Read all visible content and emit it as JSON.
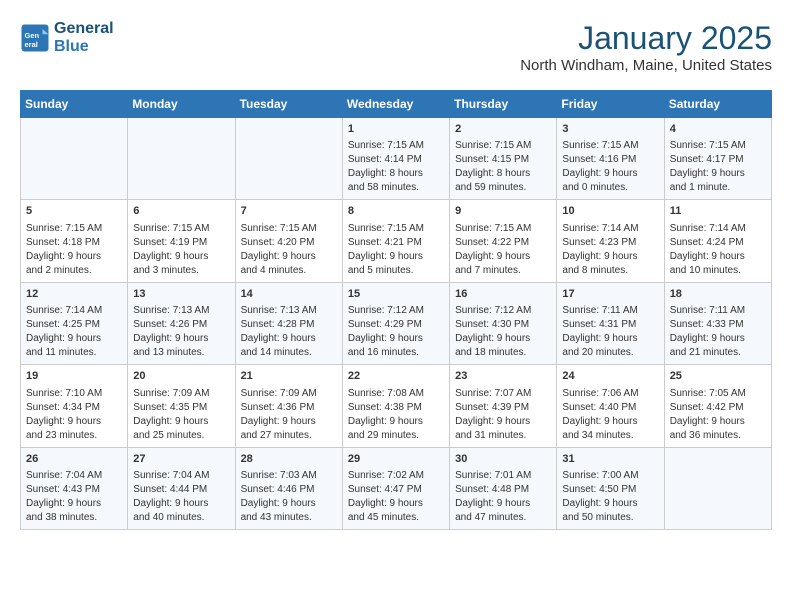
{
  "header": {
    "logo_text_general": "General",
    "logo_text_blue": "Blue",
    "month": "January 2025",
    "location": "North Windham, Maine, United States"
  },
  "days_of_week": [
    "Sunday",
    "Monday",
    "Tuesday",
    "Wednesday",
    "Thursday",
    "Friday",
    "Saturday"
  ],
  "weeks": [
    [
      {
        "day": "",
        "info": ""
      },
      {
        "day": "",
        "info": ""
      },
      {
        "day": "",
        "info": ""
      },
      {
        "day": "1",
        "info": "Sunrise: 7:15 AM\nSunset: 4:14 PM\nDaylight: 8 hours\nand 58 minutes."
      },
      {
        "day": "2",
        "info": "Sunrise: 7:15 AM\nSunset: 4:15 PM\nDaylight: 8 hours\nand 59 minutes."
      },
      {
        "day": "3",
        "info": "Sunrise: 7:15 AM\nSunset: 4:16 PM\nDaylight: 9 hours\nand 0 minutes."
      },
      {
        "day": "4",
        "info": "Sunrise: 7:15 AM\nSunset: 4:17 PM\nDaylight: 9 hours\nand 1 minute."
      }
    ],
    [
      {
        "day": "5",
        "info": "Sunrise: 7:15 AM\nSunset: 4:18 PM\nDaylight: 9 hours\nand 2 minutes."
      },
      {
        "day": "6",
        "info": "Sunrise: 7:15 AM\nSunset: 4:19 PM\nDaylight: 9 hours\nand 3 minutes."
      },
      {
        "day": "7",
        "info": "Sunrise: 7:15 AM\nSunset: 4:20 PM\nDaylight: 9 hours\nand 4 minutes."
      },
      {
        "day": "8",
        "info": "Sunrise: 7:15 AM\nSunset: 4:21 PM\nDaylight: 9 hours\nand 5 minutes."
      },
      {
        "day": "9",
        "info": "Sunrise: 7:15 AM\nSunset: 4:22 PM\nDaylight: 9 hours\nand 7 minutes."
      },
      {
        "day": "10",
        "info": "Sunrise: 7:14 AM\nSunset: 4:23 PM\nDaylight: 9 hours\nand 8 minutes."
      },
      {
        "day": "11",
        "info": "Sunrise: 7:14 AM\nSunset: 4:24 PM\nDaylight: 9 hours\nand 10 minutes."
      }
    ],
    [
      {
        "day": "12",
        "info": "Sunrise: 7:14 AM\nSunset: 4:25 PM\nDaylight: 9 hours\nand 11 minutes."
      },
      {
        "day": "13",
        "info": "Sunrise: 7:13 AM\nSunset: 4:26 PM\nDaylight: 9 hours\nand 13 minutes."
      },
      {
        "day": "14",
        "info": "Sunrise: 7:13 AM\nSunset: 4:28 PM\nDaylight: 9 hours\nand 14 minutes."
      },
      {
        "day": "15",
        "info": "Sunrise: 7:12 AM\nSunset: 4:29 PM\nDaylight: 9 hours\nand 16 minutes."
      },
      {
        "day": "16",
        "info": "Sunrise: 7:12 AM\nSunset: 4:30 PM\nDaylight: 9 hours\nand 18 minutes."
      },
      {
        "day": "17",
        "info": "Sunrise: 7:11 AM\nSunset: 4:31 PM\nDaylight: 9 hours\nand 20 minutes."
      },
      {
        "day": "18",
        "info": "Sunrise: 7:11 AM\nSunset: 4:33 PM\nDaylight: 9 hours\nand 21 minutes."
      }
    ],
    [
      {
        "day": "19",
        "info": "Sunrise: 7:10 AM\nSunset: 4:34 PM\nDaylight: 9 hours\nand 23 minutes."
      },
      {
        "day": "20",
        "info": "Sunrise: 7:09 AM\nSunset: 4:35 PM\nDaylight: 9 hours\nand 25 minutes."
      },
      {
        "day": "21",
        "info": "Sunrise: 7:09 AM\nSunset: 4:36 PM\nDaylight: 9 hours\nand 27 minutes."
      },
      {
        "day": "22",
        "info": "Sunrise: 7:08 AM\nSunset: 4:38 PM\nDaylight: 9 hours\nand 29 minutes."
      },
      {
        "day": "23",
        "info": "Sunrise: 7:07 AM\nSunset: 4:39 PM\nDaylight: 9 hours\nand 31 minutes."
      },
      {
        "day": "24",
        "info": "Sunrise: 7:06 AM\nSunset: 4:40 PM\nDaylight: 9 hours\nand 34 minutes."
      },
      {
        "day": "25",
        "info": "Sunrise: 7:05 AM\nSunset: 4:42 PM\nDaylight: 9 hours\nand 36 minutes."
      }
    ],
    [
      {
        "day": "26",
        "info": "Sunrise: 7:04 AM\nSunset: 4:43 PM\nDaylight: 9 hours\nand 38 minutes."
      },
      {
        "day": "27",
        "info": "Sunrise: 7:04 AM\nSunset: 4:44 PM\nDaylight: 9 hours\nand 40 minutes."
      },
      {
        "day": "28",
        "info": "Sunrise: 7:03 AM\nSunset: 4:46 PM\nDaylight: 9 hours\nand 43 minutes."
      },
      {
        "day": "29",
        "info": "Sunrise: 7:02 AM\nSunset: 4:47 PM\nDaylight: 9 hours\nand 45 minutes."
      },
      {
        "day": "30",
        "info": "Sunrise: 7:01 AM\nSunset: 4:48 PM\nDaylight: 9 hours\nand 47 minutes."
      },
      {
        "day": "31",
        "info": "Sunrise: 7:00 AM\nSunset: 4:50 PM\nDaylight: 9 hours\nand 50 minutes."
      },
      {
        "day": "",
        "info": ""
      }
    ]
  ]
}
